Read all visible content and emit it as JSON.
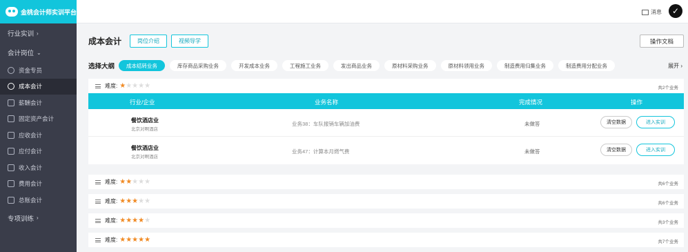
{
  "app": {
    "title": "金桃会计师实训平台"
  },
  "sidebar": {
    "sections": [
      {
        "label": "行业实训",
        "arrow": "›"
      },
      {
        "label": "会计岗位",
        "arrow": "⌄"
      },
      {
        "label": "专项训练",
        "arrow": "›"
      }
    ],
    "items": [
      {
        "label": "资金专员"
      },
      {
        "label": "成本会计"
      },
      {
        "label": "薪酬会计"
      },
      {
        "label": "固定资产会计"
      },
      {
        "label": "应收会计"
      },
      {
        "label": "应付会计"
      },
      {
        "label": "收入会计"
      },
      {
        "label": "费用会计"
      },
      {
        "label": "总账会计"
      }
    ]
  },
  "topbar": {
    "message_label": "消息",
    "avatar_glyph": "✓"
  },
  "page": {
    "title": "成本会计",
    "btn_intro": "岗位介绍",
    "btn_video": "视频导学",
    "btn_doc": "操作文档"
  },
  "outline": {
    "label": "选择大纲",
    "expand": "展开 ›",
    "chips": [
      "成本结转业务",
      "库存商品采购业务",
      "开发成本业务",
      "工程施工业务",
      "发出商品业务",
      "原材料采购业务",
      "原材料领用业务",
      "制造费用归集业务",
      "制造费用分配业务"
    ]
  },
  "difficulty_label": "难度:",
  "star_glyph": "★",
  "levels": [
    {
      "stars": 1,
      "count": "共2个业务"
    },
    {
      "stars": 2,
      "count": "共6个业务"
    },
    {
      "stars": 3,
      "count": "共6个业务"
    },
    {
      "stars": 4,
      "count": "共3个业务"
    },
    {
      "stars": 5,
      "count": "共7个业务"
    }
  ],
  "table": {
    "headers": {
      "industry": "行业/企业",
      "business": "业务名称",
      "status": "完成情况",
      "action": "操作"
    },
    "rows": [
      {
        "industry": "餐饮酒店业",
        "enterprise": "北京对啊酒店",
        "business": "业务38：车队报销车辆加油费",
        "status": "未做答",
        "clear": "清空数据",
        "enter": "进入实训"
      },
      {
        "industry": "餐饮酒店业",
        "enterprise": "北京对啊酒店",
        "business": "业务47：计算本月燃气费",
        "status": "未做答",
        "clear": "清空数据",
        "enter": "进入实训"
      }
    ]
  }
}
